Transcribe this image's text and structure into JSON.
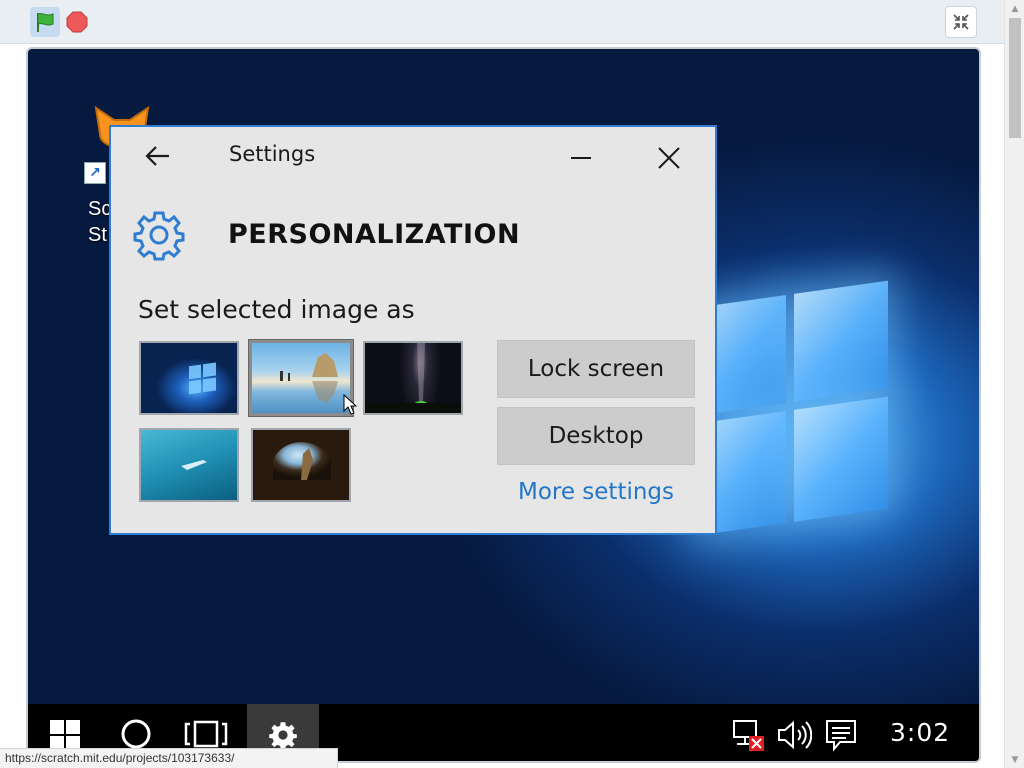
{
  "settings_window": {
    "title": "Settings",
    "section_title": "PERSONALIZATION",
    "set_label": "Set selected image as",
    "thumbnails": [
      {
        "name": "windows-hero",
        "selected": false
      },
      {
        "name": "beach-rock-reflection",
        "selected": true
      },
      {
        "name": "starry-night-tent",
        "selected": false
      },
      {
        "name": "underwater-swimmer",
        "selected": false
      },
      {
        "name": "sea-cave",
        "selected": false
      }
    ],
    "lock_screen_label": "Lock screen",
    "desktop_label": "Desktop",
    "more_settings_label": "More settings"
  },
  "desktop": {
    "icon_label": "Sc\nSt"
  },
  "taskbar": {
    "clock": "3:02"
  },
  "status_url": "https://scratch.mit.edu/projects/103173633/",
  "colors": {
    "accent": "#2f7dd3",
    "link": "#2277c9",
    "window_bg": "#e6e6e6",
    "button_bg": "#cccccc",
    "taskbar_bg": "#000000",
    "green_flag": "#3fb23b",
    "stop": "#ec5959"
  }
}
